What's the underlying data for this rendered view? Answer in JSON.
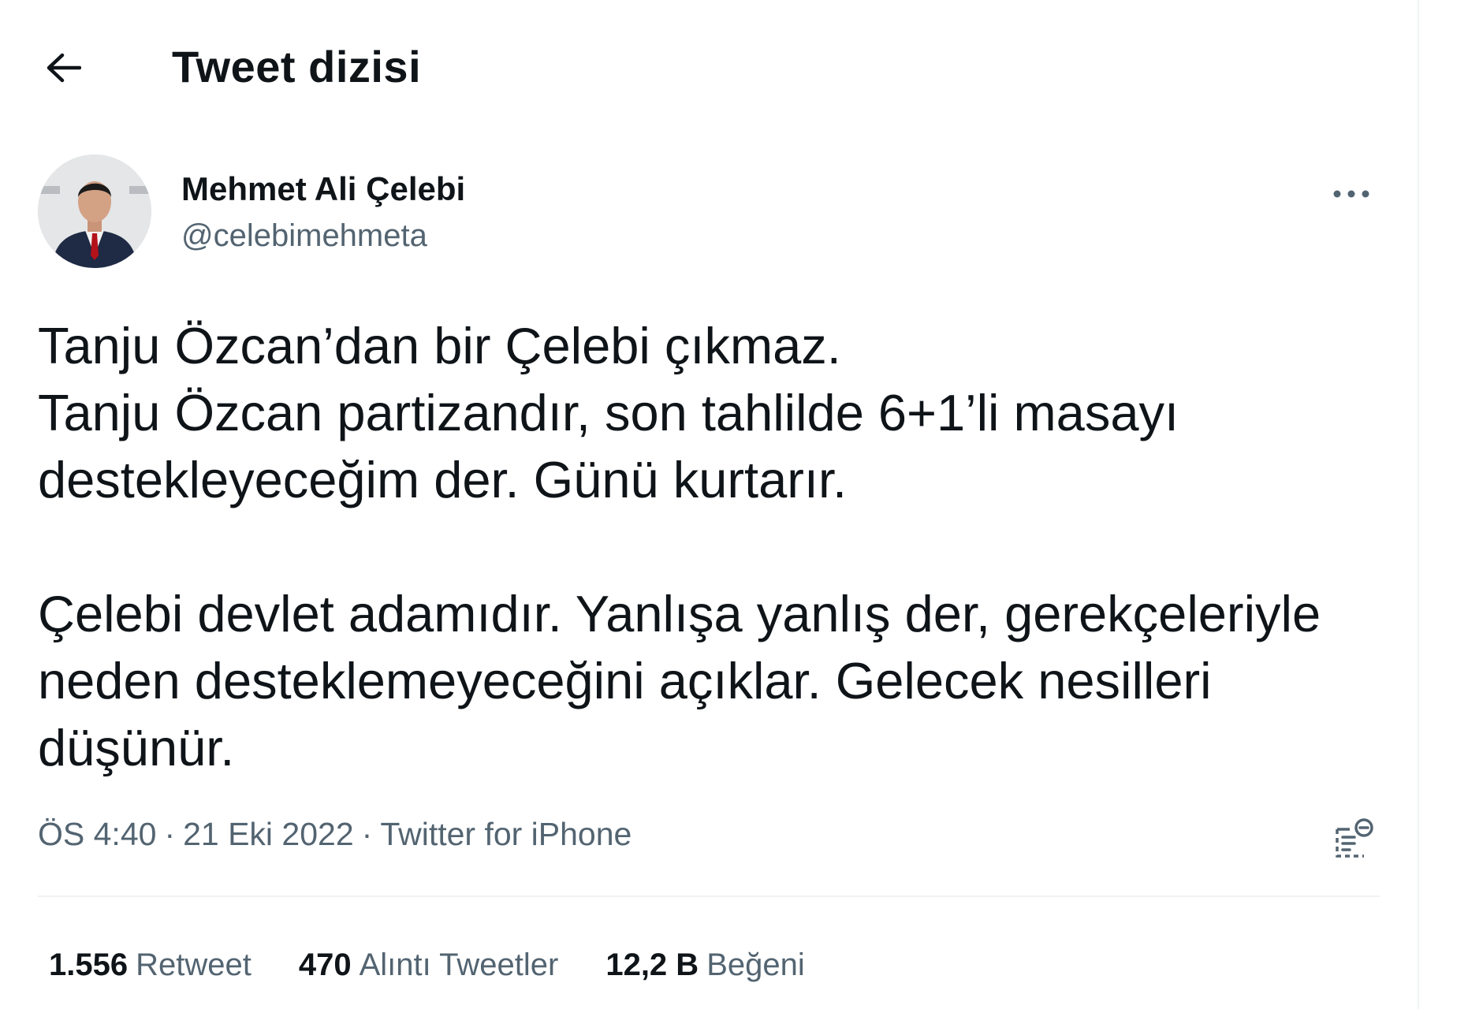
{
  "header": {
    "back_icon": "arrow-left-icon",
    "title": "Tweet dizisi"
  },
  "tweet": {
    "author": {
      "name": "Mehmet Ali Çelebi",
      "handle": "@celebimehmeta"
    },
    "more_icon": "more-horizontal-icon",
    "paragraphs": [
      [
        "Tanju Özcan’dan bir Çelebi çıkmaz.",
        "Tanju Özcan partizandır, son tahlilde 6+1’li masayı",
        "destekleyeceğim der. Günü kurtarır."
      ],
      [
        "Çelebi devlet adamıdır. Yanlışa yanlış der, gerekçeleriyle",
        "neden desteklemeyeceğini açıklar. Gelecek nesilleri",
        "düşünür."
      ]
    ],
    "meta": {
      "time": "ÖS 4:40",
      "date": "21 Eki 2022",
      "source": "Twitter for iPhone",
      "separator": "·"
    },
    "analytics_icon": "tweet-analytics-icon"
  },
  "stats": {
    "retweets": {
      "value": "1.556",
      "label": "Retweet"
    },
    "quotes": {
      "value": "470",
      "label": "Alıntı Tweetler"
    },
    "likes": {
      "value": "12,2 B",
      "label": "Beğeni"
    }
  },
  "colors": {
    "text_primary": "#0f1419",
    "text_secondary": "#536471",
    "divider": "#eff3f4"
  }
}
